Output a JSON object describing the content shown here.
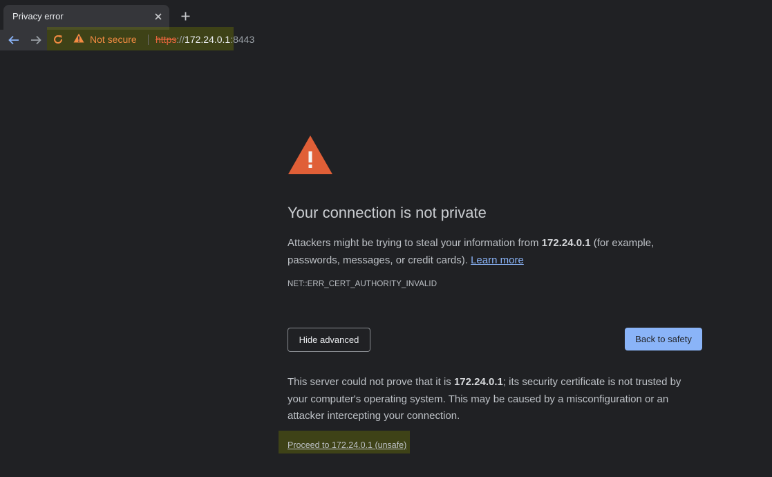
{
  "tab": {
    "title": "Privacy error",
    "close_icon": "close-icon",
    "new_tab_icon": "plus-icon"
  },
  "toolbar": {
    "back_icon": "arrow-left-icon",
    "forward_icon": "arrow-right-icon",
    "reload_icon": "reload-icon",
    "security_chip": {
      "icon": "warning-triangle-icon",
      "label": "Not secure"
    },
    "url": {
      "scheme": "https",
      "separator": "://",
      "host": "172.24.0.1",
      "port": ":8443"
    }
  },
  "page": {
    "warning_icon": "warning-triangle-icon",
    "heading": "Your connection is not private",
    "intro": {
      "before_host": "Attackers might be trying to steal your information from ",
      "host": "172.24.0.1",
      "after_host": " (for example, passwords, messages, or credit cards). ",
      "learn_more": "Learn more"
    },
    "error_code": "NET::ERR_CERT_AUTHORITY_INVALID",
    "hide_advanced_label": "Hide advanced",
    "back_to_safety_label": "Back to safety",
    "details": {
      "before_host": "This server could not prove that it is ",
      "host": "172.24.0.1",
      "after_host": "; its security certificate is not trusted by your computer's operating system. This may be caused by a misconfiguration or an attacker intercepting your connection."
    },
    "proceed_link": "Proceed to 172.24.0.1 (unsafe)"
  },
  "colors": {
    "page_background": "#202124",
    "warning": "#e05f37",
    "primary_button": "#8ab4f8",
    "link": "#8ab4f8",
    "not_secure": "#f28b42"
  }
}
